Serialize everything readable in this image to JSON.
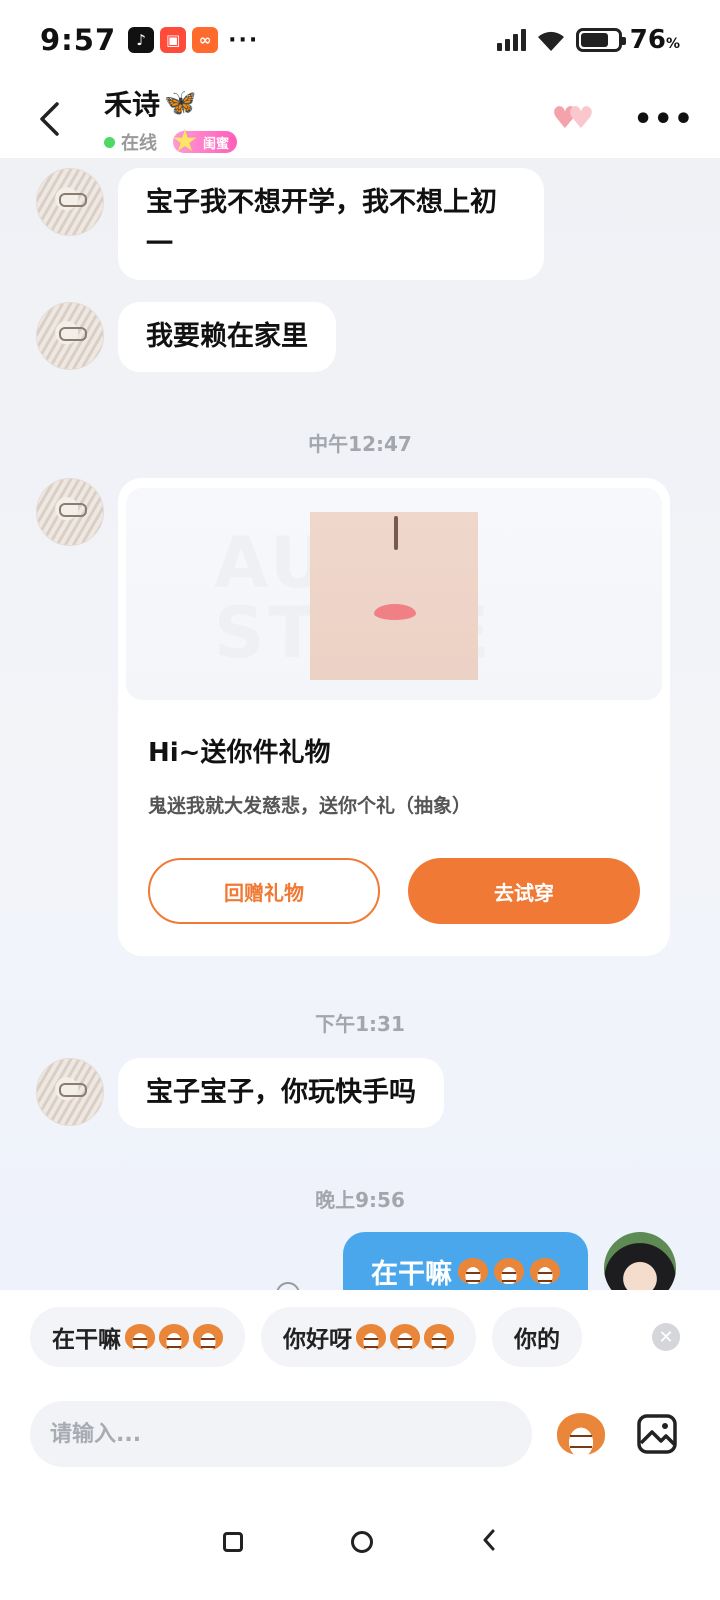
{
  "status_bar": {
    "time": "9:57",
    "app_icons": [
      "tiktok-icon",
      "red-app-icon",
      "orange-app-icon"
    ],
    "more": "···",
    "battery_percent": "76",
    "battery_unit": "%",
    "battery_level": 0.76
  },
  "header": {
    "contact_name": "禾诗",
    "status": "在线",
    "relation_badge": "闺蜜",
    "accent_color": "#f07a35"
  },
  "messages": [
    {
      "side": "left",
      "text": "宝子我不想开学，我不想上初一"
    },
    {
      "side": "left",
      "text": "我要赖在家里"
    }
  ],
  "timestamps": [
    "中午12:47",
    "下午1:31",
    "晚上9:56"
  ],
  "gift_card": {
    "title": "Hi~送你件礼物",
    "description": "鬼迷我就大发慈悲，送你个礼（抽象）",
    "return_gift_label": "回赠礼物",
    "try_on_label": "去试穿",
    "watermark": "AURA STORE"
  },
  "message_after_gift": {
    "side": "left",
    "text": "宝子宝子，你玩快手吗"
  },
  "my_message": {
    "side": "right",
    "text": "在干嘛"
  },
  "quick_replies": [
    {
      "text": "在干嘛"
    },
    {
      "text": "你好呀"
    },
    {
      "text": "你的"
    }
  ],
  "input": {
    "placeholder": "请输入..."
  }
}
